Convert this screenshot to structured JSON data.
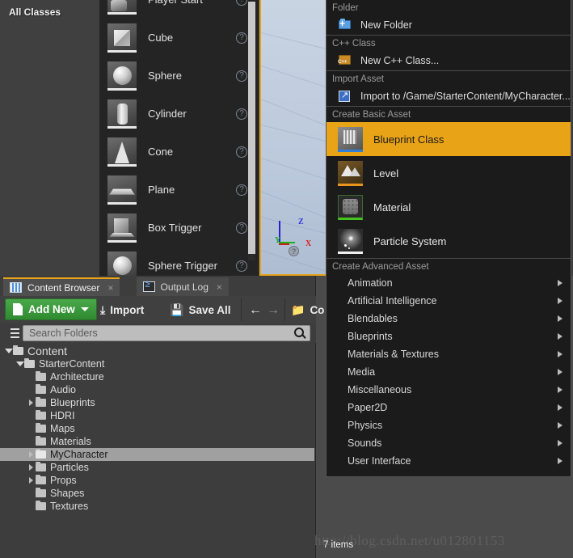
{
  "class_panel": {
    "title": "All Classes",
    "items": [
      {
        "label": "Player Start",
        "icon": "player-start-thumbnail"
      },
      {
        "label": "Cube",
        "icon": "cube-thumbnail"
      },
      {
        "label": "Sphere",
        "icon": "sphere-thumbnail"
      },
      {
        "label": "Cylinder",
        "icon": "cylinder-thumbnail"
      },
      {
        "label": "Cone",
        "icon": "cone-thumbnail"
      },
      {
        "label": "Plane",
        "icon": "plane-thumbnail"
      },
      {
        "label": "Box Trigger",
        "icon": "box-trigger-thumbnail"
      },
      {
        "label": "Sphere Trigger",
        "icon": "sphere-trigger-thumbnail"
      }
    ],
    "help_glyph": "?"
  },
  "viewport": {
    "axis_z": "Z",
    "axis_y": "Y",
    "axis_x": "X",
    "gizmo_glyph": "?",
    "border_color": "#e8a317"
  },
  "context_menu": {
    "sections": [
      {
        "header": "Folder",
        "items": [
          {
            "label": "New Folder",
            "icon": "new-folder-icon"
          }
        ]
      },
      {
        "header": "C++ Class",
        "items": [
          {
            "label": "New C++ Class...",
            "icon": "cpp-class-icon"
          }
        ]
      },
      {
        "header": "Import Asset",
        "items": [
          {
            "label": "Import to /Game/StarterContent/MyCharacter...",
            "icon": "import-asset-icon"
          }
        ]
      }
    ],
    "basic_asset_header": "Create Basic Asset",
    "basic_assets": [
      {
        "label": "Blueprint Class",
        "icon": "blueprint-class-thumbnail",
        "selected": true,
        "accent": "#2f7fd8"
      },
      {
        "label": "Level",
        "icon": "level-thumbnail",
        "selected": false,
        "accent": "#e8941a"
      },
      {
        "label": "Material",
        "icon": "material-thumbnail",
        "selected": false,
        "accent": "#46c41e"
      },
      {
        "label": "Particle System",
        "icon": "particle-system-thumbnail",
        "selected": false,
        "accent": "#f0f0f0"
      }
    ],
    "advanced_asset_header": "Create Advanced Asset",
    "advanced_assets": [
      {
        "label": "Animation"
      },
      {
        "label": "Artificial Intelligence"
      },
      {
        "label": "Blendables"
      },
      {
        "label": "Blueprints"
      },
      {
        "label": "Materials & Textures"
      },
      {
        "label": "Media"
      },
      {
        "label": "Miscellaneous"
      },
      {
        "label": "Paper2D"
      },
      {
        "label": "Physics"
      },
      {
        "label": "Sounds"
      },
      {
        "label": "User Interface"
      }
    ],
    "highlight_color": "#e8a317"
  },
  "content_browser": {
    "tabs": [
      {
        "label": "Content Browser",
        "icon": "content-browser-icon",
        "active": true,
        "close": "×"
      },
      {
        "label": "Output Log",
        "icon": "output-log-icon",
        "active": false,
        "close": "×"
      }
    ],
    "toolbar": {
      "add_new": "Add New",
      "import": "Import",
      "import_glyph": "⤓",
      "save_all": "Save All",
      "save_glyph": "ὋE",
      "back_glyph": "←",
      "forward_glyph": "→",
      "path_label": "Co"
    },
    "search": {
      "placeholder": "Search Folders",
      "icon": "search-icon"
    },
    "tree": [
      {
        "label": "Content",
        "depth": 0,
        "twisty": "open",
        "selected": false
      },
      {
        "label": "StarterContent",
        "depth": 1,
        "twisty": "open",
        "selected": false
      },
      {
        "label": "Architecture",
        "depth": 2,
        "twisty": "none",
        "selected": false
      },
      {
        "label": "Audio",
        "depth": 2,
        "twisty": "none",
        "selected": false
      },
      {
        "label": "Blueprints",
        "depth": 2,
        "twisty": "closed",
        "selected": false
      },
      {
        "label": "HDRI",
        "depth": 2,
        "twisty": "none",
        "selected": false
      },
      {
        "label": "Maps",
        "depth": 2,
        "twisty": "none",
        "selected": false
      },
      {
        "label": "Materials",
        "depth": 2,
        "twisty": "none",
        "selected": false
      },
      {
        "label": "MyCharacter",
        "depth": 2,
        "twisty": "closed",
        "selected": true
      },
      {
        "label": "Particles",
        "depth": 2,
        "twisty": "closed",
        "selected": false
      },
      {
        "label": "Props",
        "depth": 2,
        "twisty": "closed",
        "selected": false
      },
      {
        "label": "Shapes",
        "depth": 2,
        "twisty": "none",
        "selected": false
      },
      {
        "label": "Textures",
        "depth": 2,
        "twisty": "none",
        "selected": false
      }
    ],
    "status": "7 items"
  },
  "watermark": "http://blog.csdn.net/u012801153"
}
